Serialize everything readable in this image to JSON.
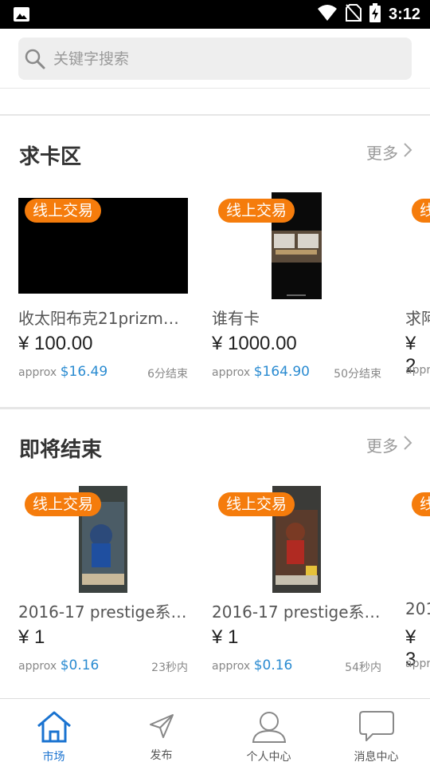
{
  "status_bar": {
    "time": "3:12"
  },
  "search": {
    "placeholder": "关键字搜索"
  },
  "sections": [
    {
      "title": "求卡区",
      "more_label": "更多",
      "cards": [
        {
          "badge": "线上交易",
          "title": "收太阳布克21prizm…",
          "price": "¥ 100.00",
          "approx_label": "approx",
          "approx_value": "$16.49",
          "time_left": "6分结束"
        },
        {
          "badge": "线上交易",
          "title": "谁有卡",
          "price": "¥ 1000.00",
          "approx_label": "approx",
          "approx_value": "$164.90",
          "time_left": "50分结束"
        },
        {
          "badge": "线",
          "title": "求阿",
          "price": "¥ 2",
          "approx_label": "appro"
        }
      ]
    },
    {
      "title": "即将结束",
      "more_label": "更多",
      "cards": [
        {
          "badge": "线上交易",
          "title": "2016-17 prestige系…",
          "price": "¥ 1",
          "approx_label": "approx",
          "approx_value": "$0.16",
          "time_left": "23秒内"
        },
        {
          "badge": "线上交易",
          "title": "2016-17 prestige系…",
          "price": "¥ 1",
          "approx_label": "approx",
          "approx_value": "$0.16",
          "time_left": "54秒内"
        },
        {
          "badge": "线",
          "title": "201",
          "price": "¥ 3",
          "approx_label": "appro"
        }
      ]
    }
  ],
  "tabs": [
    {
      "label": "市场",
      "icon": "home-icon",
      "active": true
    },
    {
      "label": "发布",
      "icon": "paper-plane-icon"
    },
    {
      "label": "个人中心",
      "icon": "user-icon"
    },
    {
      "label": "消息中心",
      "icon": "chat-bubble-icon"
    }
  ],
  "colors": {
    "accent": "#1a73d0",
    "badge": "#f57c0c",
    "usd": "#2a8bd1"
  }
}
